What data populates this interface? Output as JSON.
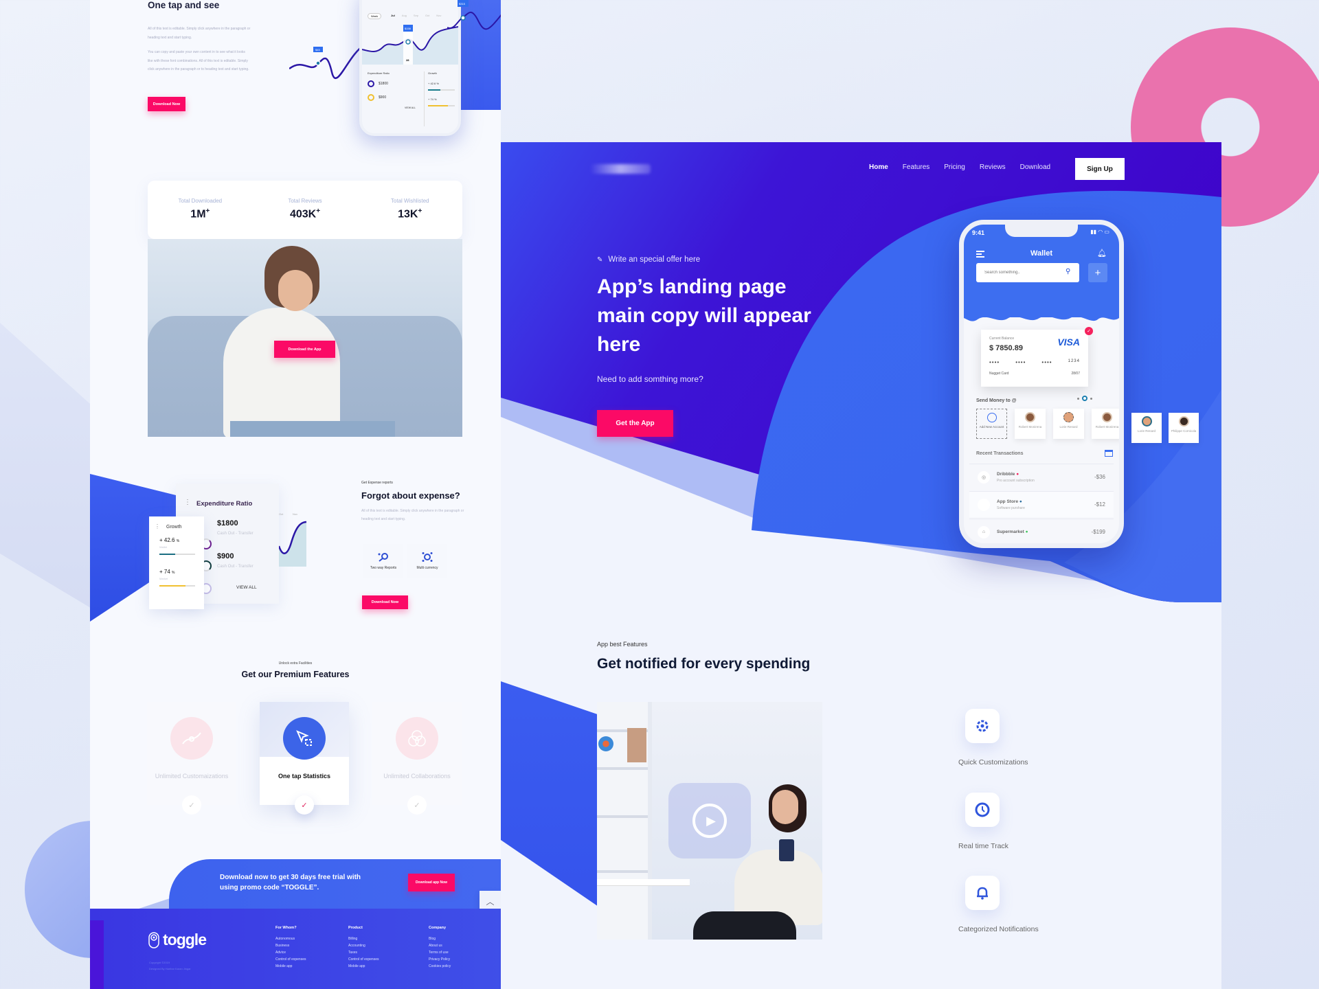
{
  "colors": {
    "accent_pink": "#fb0a66",
    "brand_blue": "#3d62ee",
    "hero_purple": "#3f04cb",
    "decor_pink": "#ea72ad"
  },
  "left": {
    "one_tap": {
      "title": "One tap and see",
      "para1": "All of this text is editable. Simply click anywhere in the paragraph or heading text and start typing.",
      "para2": "You can copy and paste your own content in to see what it looks like with these font combinations. All of this text is editable. Simply click anywhere in the paragraph or to heading text and start typing.",
      "button": "Download Now",
      "phone": {
        "period": "Week",
        "months": [
          "Jul",
          "Aug",
          "Sep",
          "Oct",
          "Nov"
        ],
        "tooltips": [
          "$45",
          "$158",
          "$315"
        ],
        "selected_day": "28",
        "expenditure_title": "Expenditure Ratio",
        "growth_title": "Growth",
        "amounts": [
          "$1800",
          "$900"
        ],
        "growth": [
          "+ 42.6 %",
          "+ 74 %"
        ],
        "view_all": "VIEW ALL"
      }
    },
    "stats": [
      {
        "label": "Total Downloaded",
        "value": "1M",
        "suffix": "+"
      },
      {
        "label": "Total Reviews",
        "value": "403K",
        "suffix": "+"
      },
      {
        "label": "Total Wishlisted",
        "value": "13K",
        "suffix": "+"
      }
    ],
    "photo_button": "Download the App",
    "expenditure": {
      "title": "Expenditure Ratio",
      "items": [
        {
          "amount": "$1800",
          "sub": "Cash Out - Transfer"
        },
        {
          "amount": "$900",
          "sub": "Cash Out - Transfer"
        }
      ],
      "view_all": "VIEW ALL",
      "chart_months": [
        "Oct",
        "Nov"
      ]
    },
    "growth": {
      "title": "Growth",
      "items": [
        {
          "value": "+ 42.6",
          "unit": "%",
          "label": "Wallet",
          "progress": 0.45
        },
        {
          "value": "+ 74",
          "unit": "%",
          "label": "Market",
          "progress": 0.74
        }
      ]
    },
    "forgot": {
      "kicker": "Get Expense reports",
      "title": "Forgot about expense?",
      "para": "All of this text is editable. Simply click anywhere in the paragraph or heading text and start typing.",
      "tiles": [
        {
          "label": "Two way Reports",
          "icon": "reports-icon"
        },
        {
          "label": "Multi currency",
          "icon": "currency-icon"
        }
      ],
      "button": "Download Now"
    },
    "premium": {
      "kicker": "Unlock extra Facilities",
      "title": "Get our Premium Features",
      "cards": [
        {
          "label": "Unlimited Customaizations",
          "icon": "customization-icon",
          "active": false
        },
        {
          "label": "One tap Statistics",
          "icon": "cursor-select-icon",
          "active": true
        },
        {
          "label": "Unlimited Collaborations",
          "icon": "collaboration-icon",
          "active": false
        }
      ]
    },
    "promo": {
      "text": "Download now to get 30 days free trial with using promo code “TOGGLE”.",
      "button": "Download app Now"
    },
    "footer": {
      "logo": "toggle",
      "copyright": "Copyright ©2019",
      "designed_by": "Designed By Harihar Karan Jingar",
      "columns": [
        {
          "title": "For Whom?",
          "items": [
            "Autonomous",
            "Business",
            "Advice",
            "Control of expenses",
            "Mobile app"
          ]
        },
        {
          "title": "Product",
          "items": [
            "Billing",
            "Accounting",
            "Taxes",
            "Control of expenses",
            "Mobile app"
          ]
        },
        {
          "title": "Company",
          "items": [
            "Blog",
            "About us",
            "Terms of use",
            "Privacy Policy",
            "Cookies policy"
          ]
        }
      ]
    }
  },
  "right": {
    "nav": {
      "logo": "toggle",
      "items": [
        "Home",
        "Features",
        "Pricing",
        "Reviews",
        "Download"
      ],
      "active": "Home",
      "signup": "Sign Up"
    },
    "hero": {
      "offer": "Write an special offer here",
      "headline": "App’s landing page main copy will appear here",
      "subhead": "Need to add somthing more?",
      "cta": "Get the App"
    },
    "phone": {
      "time": "9:41",
      "title": "Wallet",
      "search_placeholder": "Search something..",
      "card": {
        "label": "Current Balance",
        "balance": "$ 7850.89",
        "brand": "VISA",
        "masked": [
          "••••",
          "••••",
          "••••",
          "1234"
        ],
        "name": "Nugget Card",
        "expiry": "28/07"
      },
      "send_title": "Send Money to @",
      "contacts": [
        {
          "name": "Add New Account",
          "add": true
        },
        {
          "name": "Robert Monirena"
        },
        {
          "name": "Lorie Renard"
        },
        {
          "name": "Robert Monirena"
        },
        {
          "name": "Lorie Renard"
        },
        {
          "name": "Philippe Cornicola"
        }
      ],
      "recent_title": "Recent Transactions",
      "transactions": [
        {
          "name": "Dribbble",
          "sub": "Pro account subscription",
          "amount": "-$36",
          "dot": "#f5225d",
          "icon": "dribbble-icon"
        },
        {
          "name": "App Store",
          "sub": "Software purshare",
          "amount": "-$12",
          "dot": "#2c6ea0",
          "icon": "apple-icon"
        },
        {
          "name": "Supermarket",
          "sub": "",
          "amount": "-$199",
          "dot": "#3cc45a",
          "icon": "basket-icon"
        }
      ]
    },
    "features": {
      "kicker": "App best Features",
      "title": "Get notified for every spending",
      "items": [
        {
          "label": "Quick Customizations",
          "icon": "gear-icon"
        },
        {
          "label": "Real time Track",
          "icon": "clock-icon"
        },
        {
          "label": "Categorized Notifications",
          "icon": "bell-icon"
        }
      ]
    }
  }
}
